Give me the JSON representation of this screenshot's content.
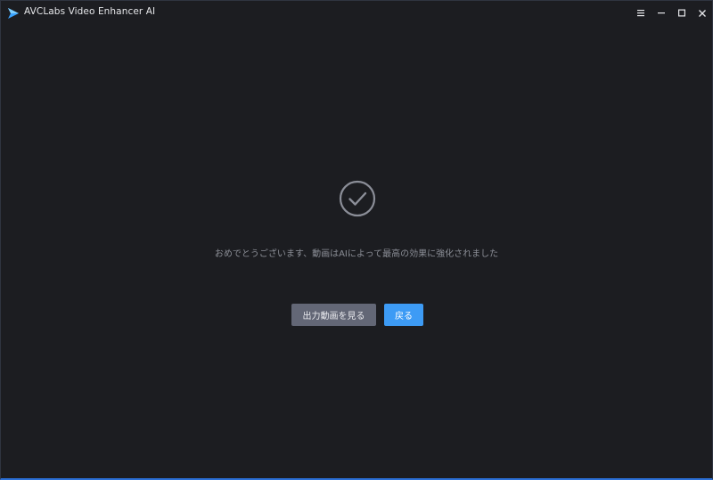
{
  "window": {
    "title": "AVCLabs Video Enhancer AI",
    "controls": {
      "menu_icon": "hamburger-menu-icon",
      "minimize_icon": "minimize-icon",
      "maximize_icon": "maximize-icon",
      "close_icon": "close-icon"
    }
  },
  "main": {
    "status_icon": "check-circle-icon",
    "message": "おめでとうございます、動画はAIによって最高の効果に強化されました",
    "buttons": {
      "view_output": "出力動画を見る",
      "back": "戻る"
    }
  },
  "colors": {
    "background": "#1c1d21",
    "accent": "#3d9bf5",
    "secondary_button": "#636776",
    "message_text": "#8b8e96"
  }
}
